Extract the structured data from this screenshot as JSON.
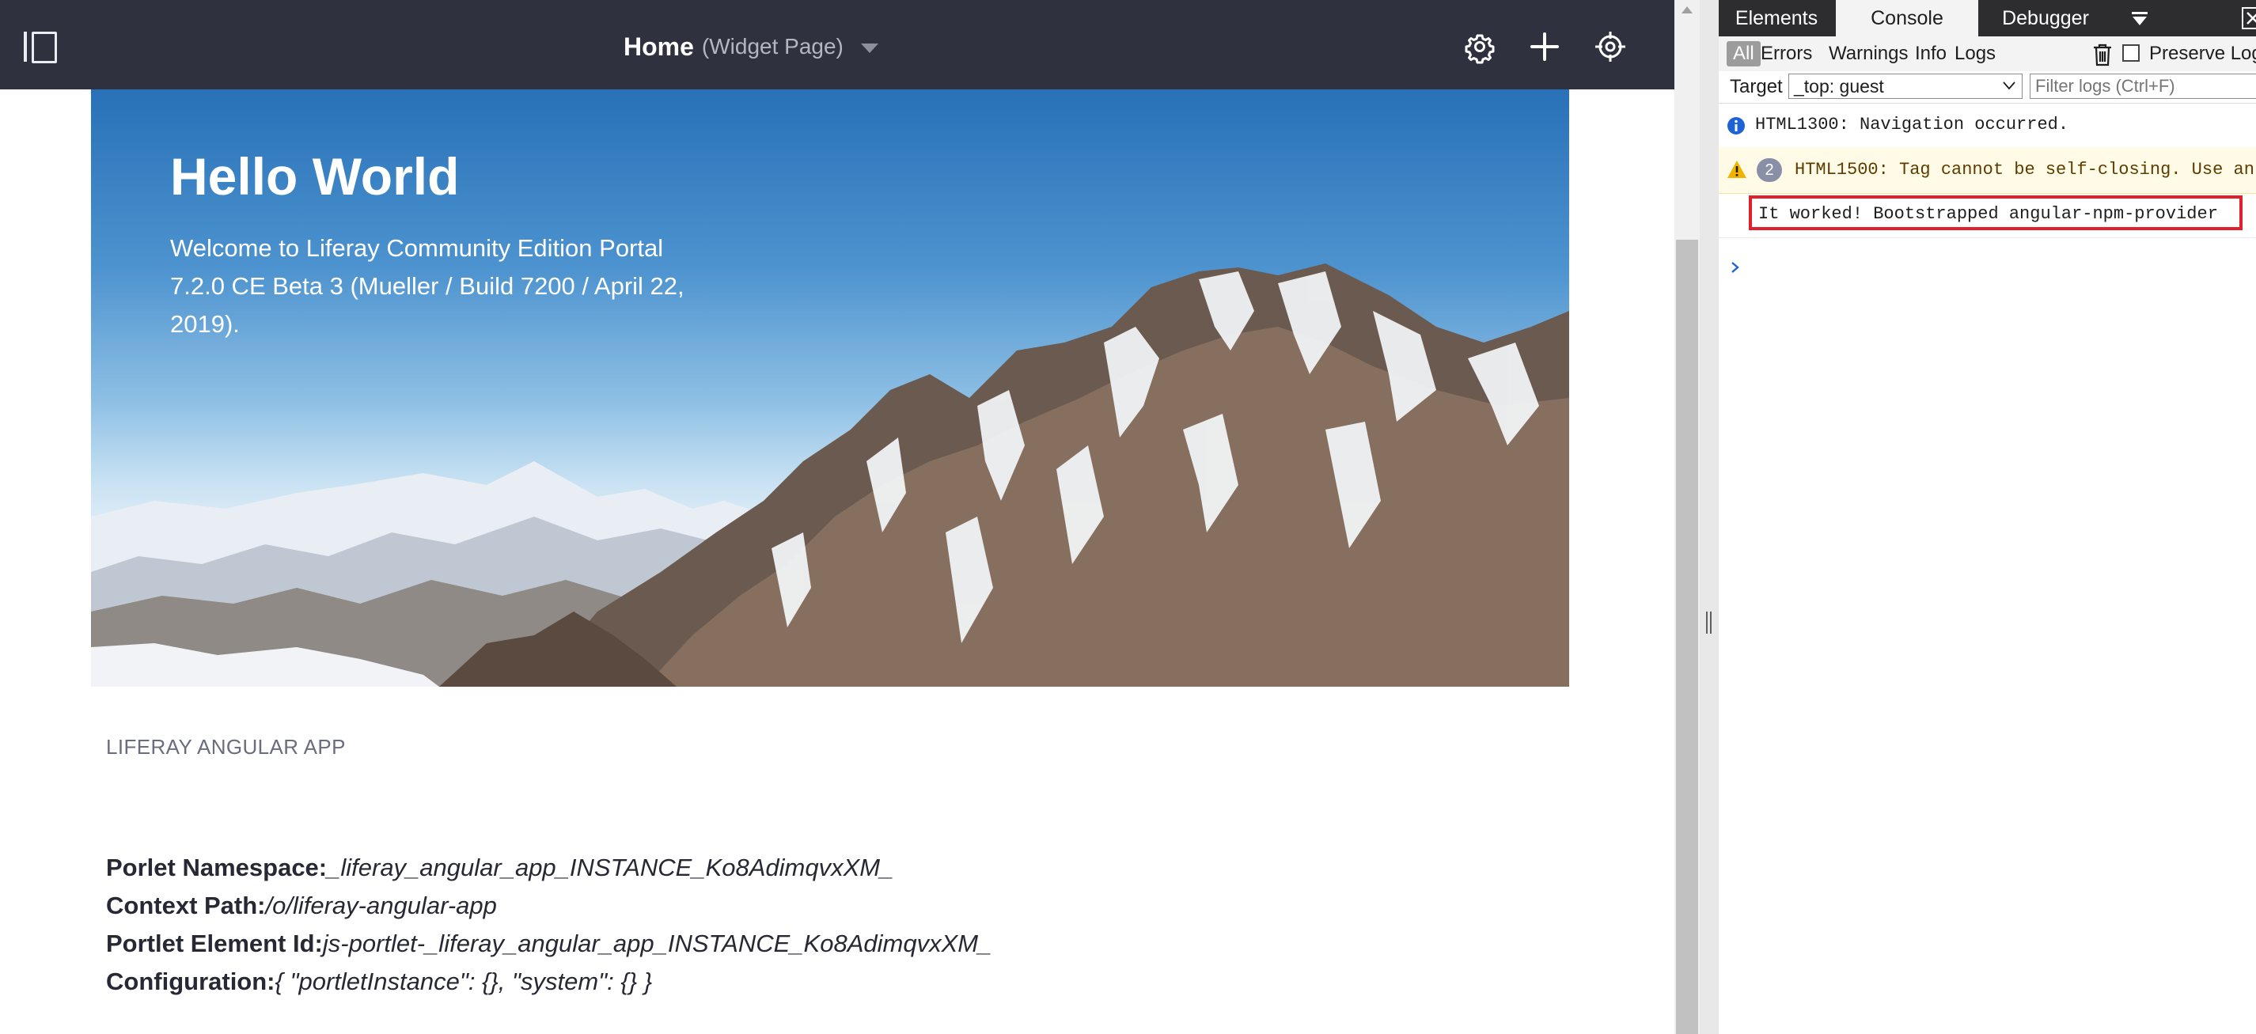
{
  "header": {
    "title": "Home",
    "subtitle": "(Widget Page)",
    "icons": [
      "sidebar-toggle-icon",
      "gear-icon",
      "plus-icon",
      "simulation-icon"
    ]
  },
  "hero": {
    "title": "Hello World",
    "text": "Welcome to Liferay Community Edition Portal 7.2.0 CE Beta 3 (Mueller / Build 7200 / April 22, 2019)."
  },
  "portlet": {
    "title": "LIFERAY ANGULAR APP",
    "rows": [
      {
        "label": "Porlet Namespace:",
        "value": "_liferay_angular_app_INSTANCE_Ko8AdimqvxXM_"
      },
      {
        "label": "Context Path:",
        "value": "/o/liferay-angular-app"
      },
      {
        "label": "Portlet Element Id:",
        "value": "js-portlet-_liferay_angular_app_INSTANCE_Ko8AdimqvxXM_"
      },
      {
        "label": "Configuration:",
        "value": "{ \"portletInstance\": {}, \"system\": {} }"
      }
    ]
  },
  "devtools": {
    "tabs": [
      "Elements",
      "Console",
      "Debugger"
    ],
    "active_tab": "Console",
    "filters": [
      "All",
      "Errors",
      "Warnings",
      "Info",
      "Logs"
    ],
    "active_filter": "All",
    "preserve_log": "Preserve Log",
    "target_label": "Target",
    "target_value": "_top: guest",
    "filter_placeholder": "Filter logs (Ctrl+F)",
    "messages": {
      "info": "HTML1300: Navigation occurred.",
      "warning_count": "2",
      "warning": "HTML1500: Tag cannot be self-closing. Use an",
      "log": "It worked! Bootstrapped angular-npm-provider"
    }
  },
  "colors": {
    "topbar": "#30313f",
    "devtools_tabbar": "#2d2d30",
    "highlight_border": "#e0202a",
    "info_blue": "#1e63d6",
    "warn_yellow": "#f2b300"
  }
}
